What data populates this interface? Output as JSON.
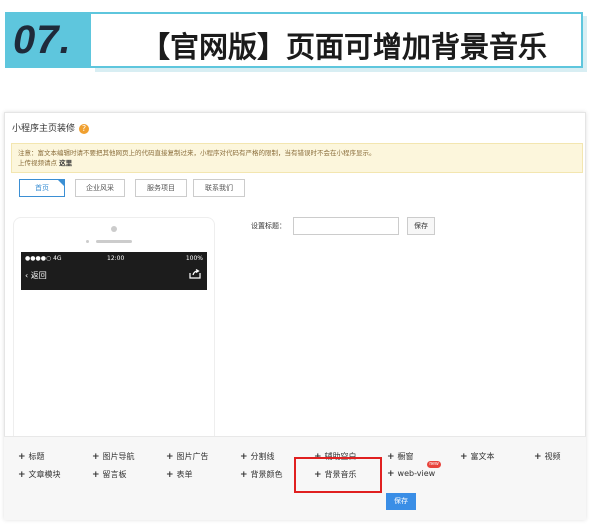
{
  "banner": {
    "number": "07.",
    "title": "【官网版】页面可增加背景音乐"
  },
  "page": {
    "title": "小程序主页装修",
    "help_icon": "question-icon",
    "notice_line1": "注意：富文本编辑时请不要把其他网页上的代码直接复制过来，小程序对代码有严格的限制，当有错误时不会在小程序显示。",
    "notice_line2_prefix": "上传视频请点",
    "notice_line2_link": "这里"
  },
  "tabs": [
    {
      "label": "首页",
      "active": true
    },
    {
      "label": "企业风采",
      "active": false
    },
    {
      "label": "服务项目",
      "active": false
    },
    {
      "label": "联系我们",
      "active": false
    }
  ],
  "phone": {
    "status_left": "●●●●○ 4G",
    "status_time": "12:00",
    "status_battery": "100%",
    "back_label": "返回",
    "share_icon": "share-icon"
  },
  "settings": {
    "label": "设置标题：",
    "input_value": "",
    "save_label": "保存"
  },
  "components": {
    "row1": [
      "标题",
      "图片导航",
      "图片广告",
      "分割线",
      "辅助空白",
      "橱窗",
      "富文本",
      "视频"
    ],
    "row2": [
      "文章模块",
      "留言板",
      "表单",
      "背景颜色",
      "背景音乐",
      "web-view"
    ],
    "new_badge": "new",
    "save_label": "保存"
  },
  "colors": {
    "accent": "#5ec6dd",
    "highlight": "#e02020",
    "primary_button": "#3a8ee6",
    "notice_bg": "#fcf6dc"
  }
}
